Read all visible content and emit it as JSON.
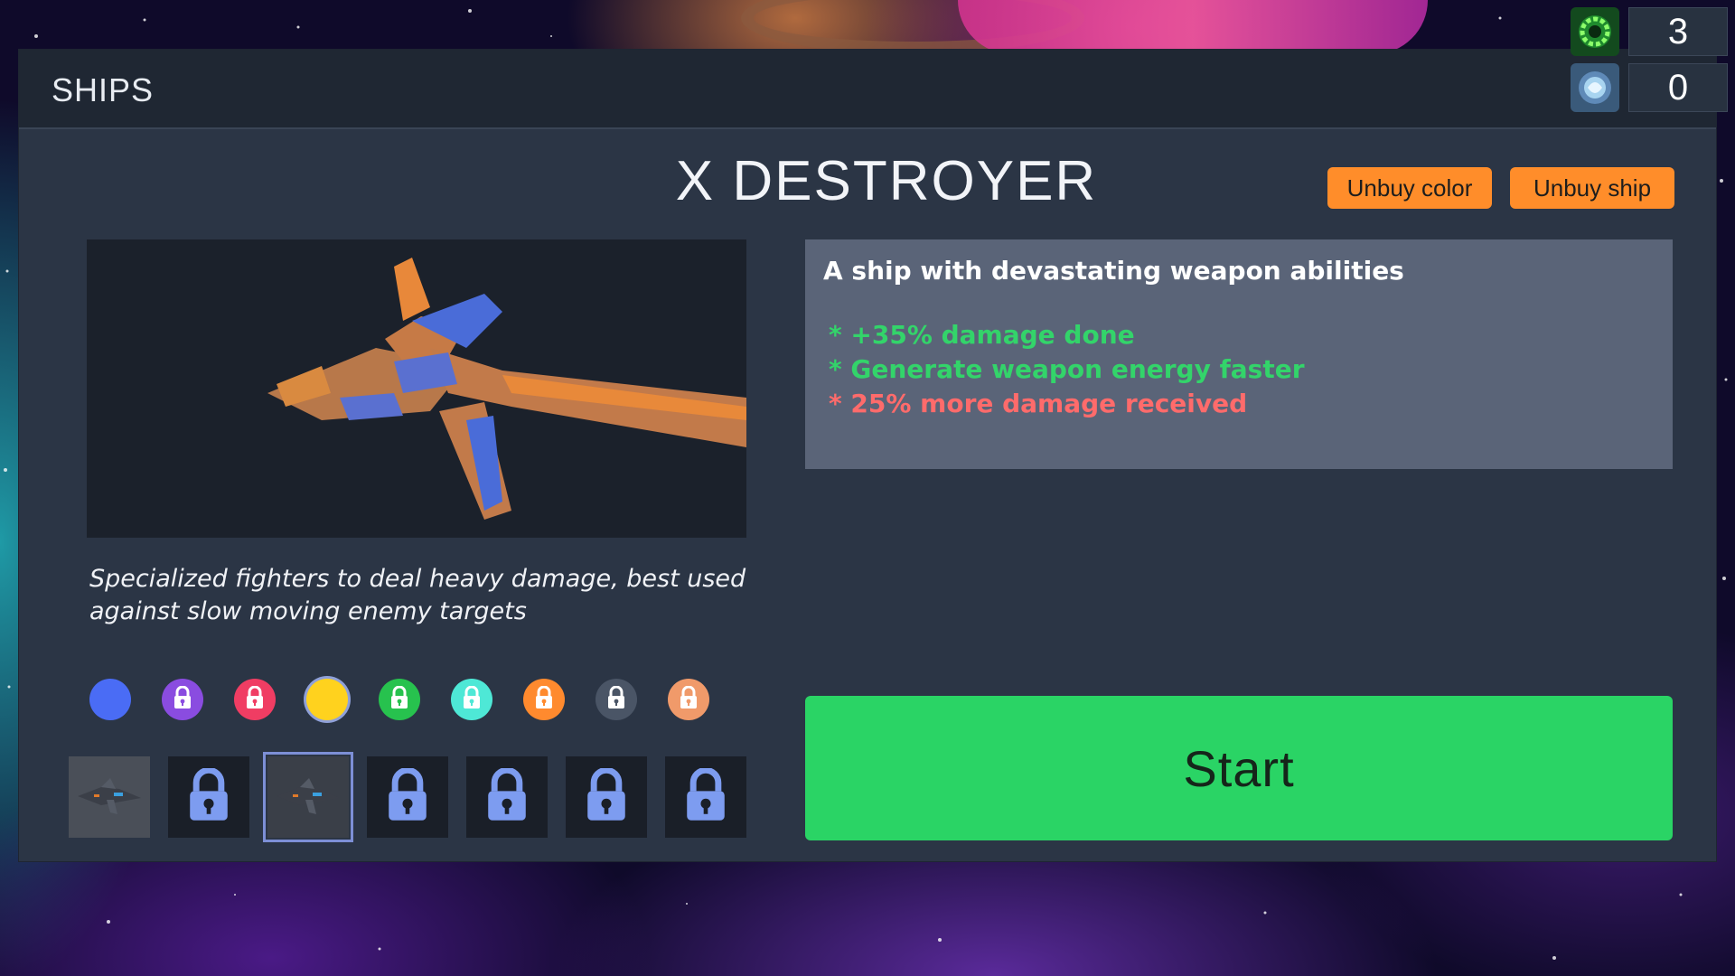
{
  "header": {
    "title": "SHIPS"
  },
  "currencies": [
    {
      "icon": "green-gear-icon",
      "value": "3"
    },
    {
      "icon": "blue-orb-icon",
      "value": "0"
    }
  ],
  "ship": {
    "name": "X DESTROYER",
    "description": "Specialized fighters to deal heavy damage, best used against slow moving enemy targets",
    "info_heading": "A ship with devastating weapon abilities",
    "bonuses": [
      {
        "text": "* +35% damage done",
        "type": "positive"
      },
      {
        "text": "* Generate weapon energy faster",
        "type": "positive"
      },
      {
        "text": "* 25% more damage received",
        "type": "negative"
      }
    ]
  },
  "buttons": {
    "unbuy_color": "Unbuy color",
    "unbuy_ship": "Unbuy ship",
    "start": "Start"
  },
  "colors": {
    "accent_positive": "#33d46a",
    "accent_negative": "#ff6b6b",
    "button_orange": "#ff8d2a",
    "start_green": "#2ad465",
    "swatches": [
      {
        "color": "#4a6cf5",
        "locked": false,
        "selected": false
      },
      {
        "color": "#8a4ce0",
        "locked": true,
        "selected": false
      },
      {
        "color": "#f03d63",
        "locked": true,
        "selected": false
      },
      {
        "color": "#ffd21e",
        "locked": false,
        "selected": true
      },
      {
        "color": "#27c24e",
        "locked": true,
        "selected": false
      },
      {
        "color": "#4ee8d6",
        "locked": true,
        "selected": false
      },
      {
        "color": "#ff8a2e",
        "locked": true,
        "selected": false
      },
      {
        "color": "#4a5566",
        "locked": true,
        "selected": false
      },
      {
        "color": "#f09a6a",
        "locked": true,
        "selected": false
      }
    ]
  },
  "ship_slots": [
    {
      "state": "owned",
      "selected": false
    },
    {
      "state": "locked",
      "selected": false
    },
    {
      "state": "owned",
      "selected": true
    },
    {
      "state": "locked",
      "selected": false
    },
    {
      "state": "locked",
      "selected": false
    },
    {
      "state": "locked",
      "selected": false
    },
    {
      "state": "locked",
      "selected": false
    }
  ]
}
